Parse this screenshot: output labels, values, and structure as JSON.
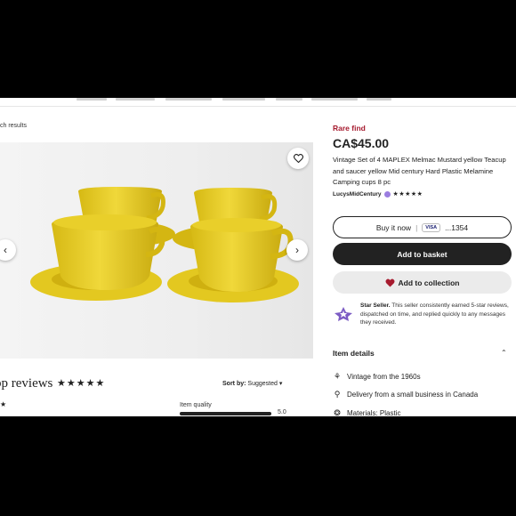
{
  "breadcrumb": {
    "text": "ch results"
  },
  "listing": {
    "rare_label": "Rare find",
    "price": "CA$45.00",
    "title": "Vintage Set of 4 MAPLEX Melmac Mustard yellow Teacup and saucer yellow Mid century Hard Plastic Melamine Camping cups 8 pc",
    "shop_name": "LucysMidCentury",
    "shop_stars": "★★★★★"
  },
  "buttons": {
    "buy_now": "Buy it now",
    "separator": "|",
    "card_brand": "VISA",
    "card_digits": "...1354",
    "add_to_basket": "Add to basket",
    "add_to_collection": "Add to collection"
  },
  "star_seller": {
    "title": "Star Seller.",
    "text": " This seller consistently earned 5-star reviews, dispatched on time, and replied quickly to any messages they received."
  },
  "item_details": {
    "heading": "Item details",
    "chevron": "⌃",
    "rows": [
      {
        "icon": "vintage-icon",
        "glyph": "⚘",
        "text": "Vintage from the 1960s"
      },
      {
        "icon": "location-pin-icon",
        "glyph": "⚲",
        "text": "Delivery from a small business in Canada"
      },
      {
        "icon": "materials-icon",
        "glyph": "❂",
        "text": "Materials: Plastic"
      }
    ]
  },
  "reviews": {
    "title": "op reviews",
    "stars": "★★★★★",
    "sort_label": "Sort by:",
    "sort_value": "Suggested",
    "sort_caret": "▾",
    "first_star": "★",
    "item_quality_label": "Item quality",
    "item_quality_value": "5.0",
    "item_quality_fraction": 1.0
  },
  "gallery": {
    "prev_glyph": "‹",
    "next_glyph": "›"
  },
  "colors": {
    "accent_red": "#a61a2e",
    "cup_yellow": "#e3c820",
    "star_seller_purple": "#7c5cc4"
  }
}
